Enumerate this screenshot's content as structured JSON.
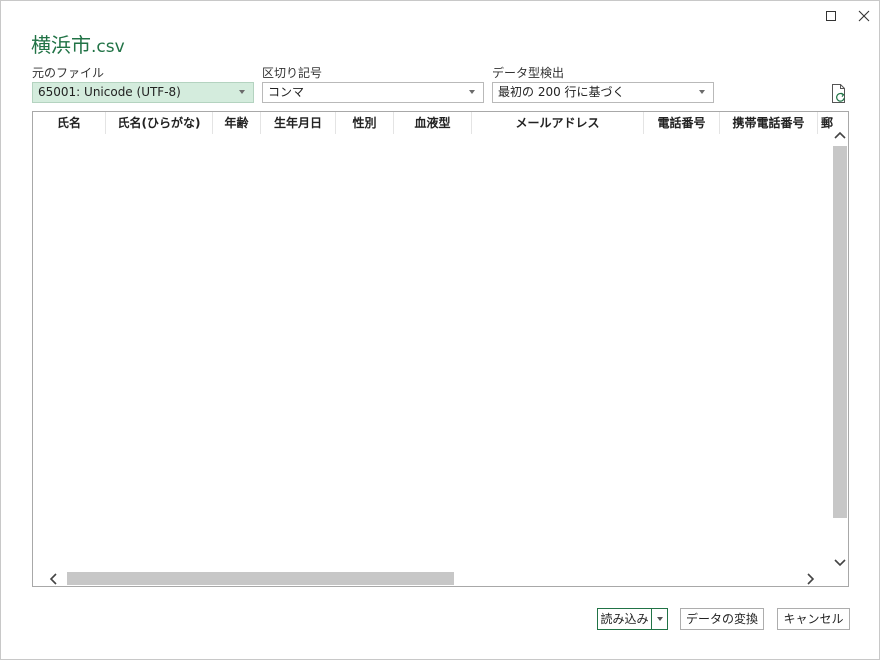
{
  "window": {
    "title_name": "横浜市",
    "title_ext": ".csv",
    "maximize_icon": "maximize-icon",
    "close_icon": "close-icon"
  },
  "options": {
    "file_origin": {
      "label": "元のファイル",
      "value": "65001: Unicode (UTF-8)"
    },
    "delimiter": {
      "label": "区切り記号",
      "value": "コンマ"
    },
    "data_type_detection": {
      "label": "データ型検出",
      "value": "最初の 200 行に基づく"
    },
    "refresh_icon": "refresh-file-icon"
  },
  "table": {
    "columns": [
      "氏名",
      "氏名(ひらがな)",
      "年齢",
      "生年月日",
      "性別",
      "血液型",
      "メールアドレス",
      "電話番号",
      "携帯電話番号",
      "郵"
    ]
  },
  "buttons": {
    "load": "読み込み",
    "transform": "データの変換",
    "cancel": "キャンセル"
  },
  "colors": {
    "accent": "#217346",
    "selected_fill": "#d4ecdd"
  }
}
